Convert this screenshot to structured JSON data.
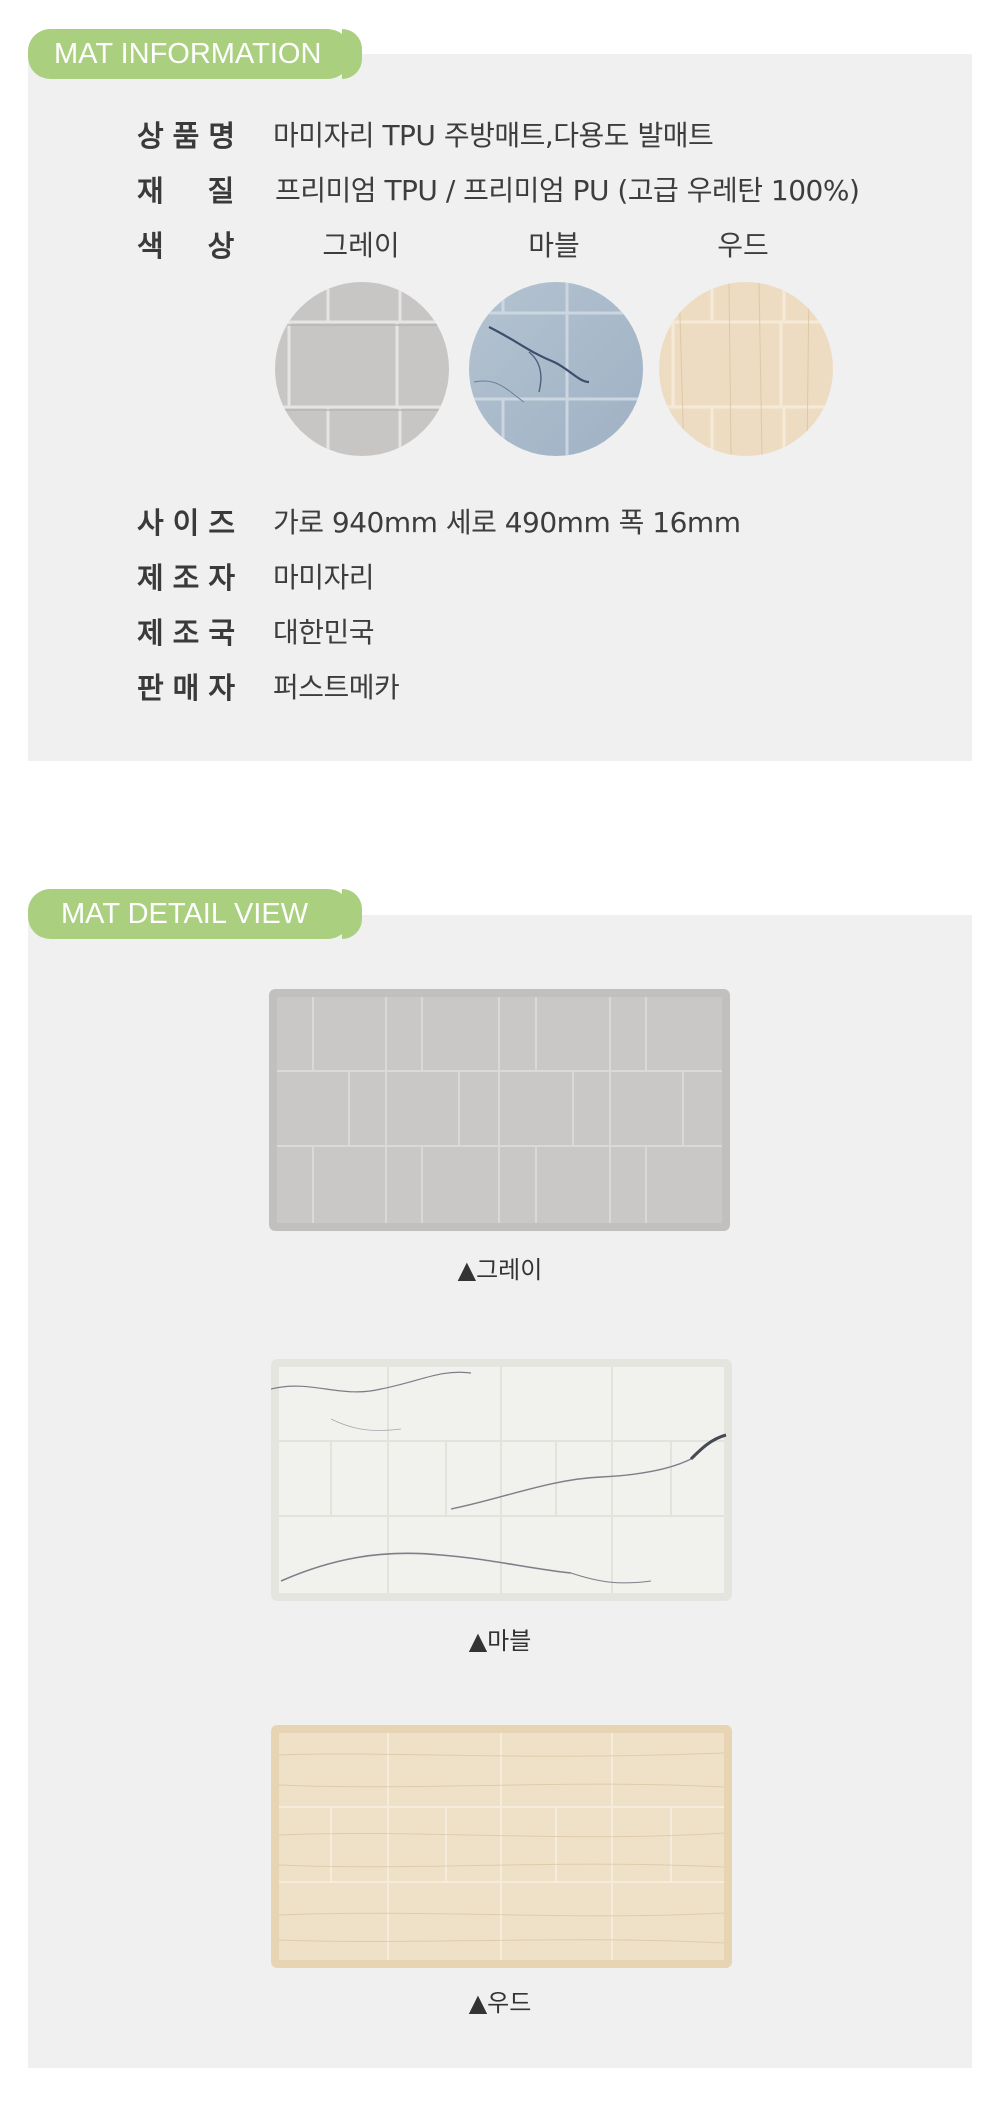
{
  "info": {
    "tag": "MAT INFORMATION",
    "rows": [
      {
        "label": "상품명",
        "value": "마미자리 TPU 주방매트,다용도 발매트"
      },
      {
        "label": "재질",
        "value": "프리미엄 TPU / 프리미엄 PU (고급 우레탄 100%)"
      },
      {
        "label": "색상",
        "value": ""
      },
      {
        "label": "사이즈",
        "value": "가로 940mm 세로 490mm 폭 16mm"
      },
      {
        "label": "제조자",
        "value": "마미자리"
      },
      {
        "label": "제조국",
        "value": "대한민국"
      },
      {
        "label": "판매자",
        "value": "퍼스트메카"
      }
    ],
    "colors": [
      "그레이",
      "마블",
      "우드"
    ]
  },
  "detail": {
    "tag": "MAT DETAIL VIEW",
    "items": [
      {
        "caption": "▲그레이"
      },
      {
        "caption": "▲마블"
      },
      {
        "caption": "▲우드"
      }
    ]
  },
  "theme": {
    "accent": "#a9cf7f",
    "panel": "#f0f0f0",
    "gray": "#c9c6c6",
    "marble": "#a9b9c9",
    "wood": "#ecdcc0"
  }
}
